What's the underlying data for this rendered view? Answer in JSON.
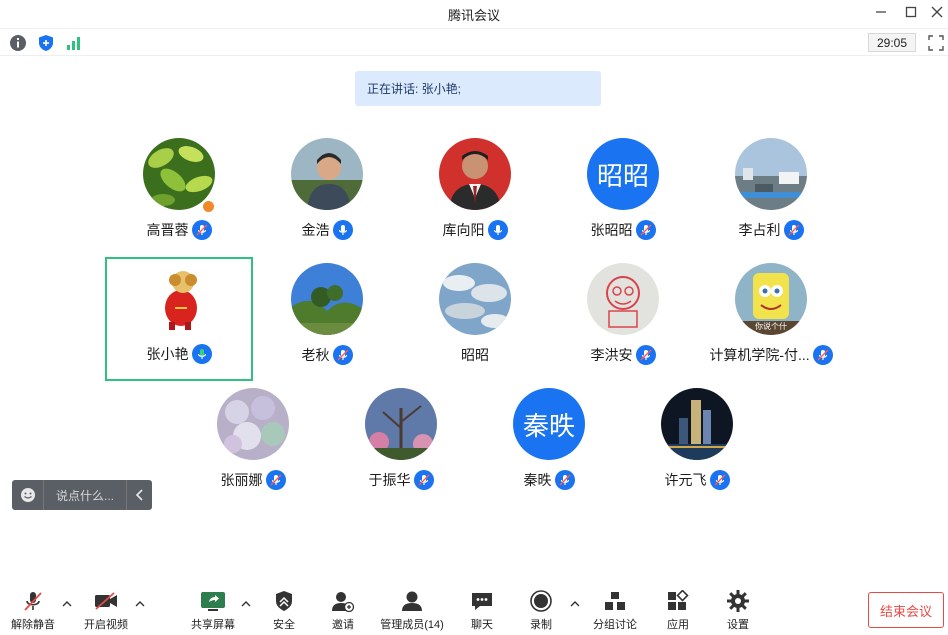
{
  "window": {
    "title": "腾讯会议"
  },
  "infobar": {
    "timer": "29:05"
  },
  "speaking": {
    "text": "正在讲话: 张小艳;"
  },
  "participants": [
    {
      "name": "高晋蓉",
      "avatar": "photo-plant"
    },
    {
      "name": "金浩",
      "avatar": "photo-man-outdoor"
    },
    {
      "name": "库向阳",
      "avatar": "photo-man-suit"
    },
    {
      "name": "张昭昭",
      "avatar_text": "昭昭"
    },
    {
      "name": "李占利",
      "avatar": "photo-city"
    },
    {
      "name": "张小艳",
      "avatar": "photo-red-toy"
    },
    {
      "name": "老秋",
      "avatar": "photo-landscape"
    },
    {
      "name": "昭昭",
      "avatar": "photo-clouds"
    },
    {
      "name": "李洪安",
      "avatar": "photo-monkey-sketch"
    },
    {
      "name": "计算机学院-付...",
      "avatar": "photo-cartoon",
      "avatar_caption": "你说个什"
    },
    {
      "name": "张丽娜",
      "avatar": "photo-plush"
    },
    {
      "name": "于振华",
      "avatar": "photo-blossom"
    },
    {
      "name": "秦昳",
      "avatar_text": "秦昳"
    },
    {
      "name": "许元飞",
      "avatar": "photo-night-city"
    }
  ],
  "chat": {
    "placeholder": "说点什么..."
  },
  "toolbar": {
    "unmute": "解除静音",
    "video": "开启视频",
    "share": "共享屏幕",
    "security": "安全",
    "invite": "邀请",
    "members": "管理成员(14)",
    "chat": "聊天",
    "record": "录制",
    "breakout": "分组讨论",
    "apps": "应用",
    "settings": "设置",
    "end": "结束会议"
  },
  "colors": {
    "accent": "#1a73f0",
    "active_border": "#2ec27e",
    "end": "#e64a45"
  }
}
